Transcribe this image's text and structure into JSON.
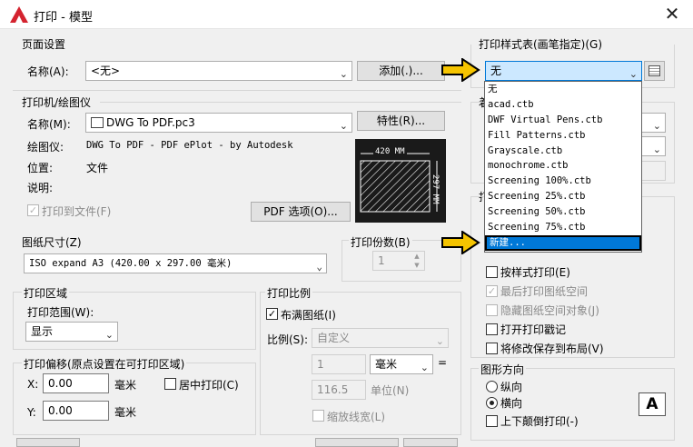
{
  "window": {
    "title": "打印 - 模型",
    "close_glyph": "✕"
  },
  "page_setup": {
    "group_label": "页面设置",
    "name_label": "名称(A):",
    "name_value": "<无>",
    "add_button": "添加(.)..."
  },
  "plotter": {
    "group_label": "打印机/绘图仪",
    "name_label": "名称(M):",
    "device_icon": "printer-icon",
    "name_value": "DWG To PDF.pc3",
    "properties_button": "特性(R)...",
    "plotter_label": "绘图仪:",
    "plotter_value": "DWG To PDF - PDF ePlot - by Autodesk",
    "location_label": "位置:",
    "location_value": "文件",
    "description_label": "说明:",
    "plot_to_file": "打印到文件(F)",
    "pdf_options_button": "PDF 选项(O)...",
    "preview_width": "420 MM",
    "preview_height": "297 MM"
  },
  "paper_size": {
    "group_label": "图纸尺寸(Z)",
    "value": "ISO expand A3 (420.00 x 297.00 毫米)"
  },
  "copies": {
    "label": "打印份数(B)",
    "value": "1"
  },
  "plot_area": {
    "group_label": "打印区域",
    "range_label": "打印范围(W):",
    "range_value": "显示"
  },
  "plot_offset": {
    "group_label": "打印偏移(原点设置在可打印区域)",
    "x_label": "X:",
    "x_value": "0.00",
    "x_unit": "毫米",
    "y_label": "Y:",
    "y_value": "0.00",
    "y_unit": "毫米",
    "center_label": "居中打印(C)"
  },
  "plot_scale": {
    "group_label": "打印比例",
    "fit_label": "布满图纸(I)",
    "scale_label": "比例(S):",
    "scale_value": "自定义",
    "value1": "1",
    "unit1": "毫米",
    "equals": "=",
    "value2": "116.5",
    "unit2": "单位(N)",
    "lineweights": "缩放线宽(L)"
  },
  "plot_style_table": {
    "group_label": "打印样式表(画笔指定)(G)",
    "value": "无",
    "options": [
      "无",
      "acad.ctb",
      "DWF Virtual Pens.ctb",
      "Fill Patterns.ctb",
      "Grayscale.ctb",
      "monochrome.ctb",
      "Screening 100%.ctb",
      "Screening 25%.ctb",
      "Screening 50%.ctb",
      "Screening 75%.ctb",
      "新建..."
    ],
    "selected_index": 10
  },
  "shaded_viewport": {
    "group_label_partial": "着"
  },
  "plot_options": {
    "group_label_partial": "打",
    "items": [
      {
        "label": "按样式打印(E)",
        "checked": false,
        "enabled": true
      },
      {
        "label": "最后打印图纸空间",
        "checked": true,
        "enabled": false
      },
      {
        "label": "隐藏图纸空间对象(J)",
        "checked": false,
        "enabled": false
      },
      {
        "label": "打开打印戳记",
        "checked": false,
        "enabled": true
      },
      {
        "label": "将修改保存到布局(V)",
        "checked": false,
        "enabled": true
      }
    ]
  },
  "orientation": {
    "group_label": "图形方向",
    "portrait": "纵向",
    "landscape": "横向",
    "upside_down": "上下颠倒打印(-)",
    "icon_letter": "A"
  },
  "glyphs": {
    "chevron": "⌄",
    "check": "✓",
    "up": "▲",
    "down": "▼"
  }
}
